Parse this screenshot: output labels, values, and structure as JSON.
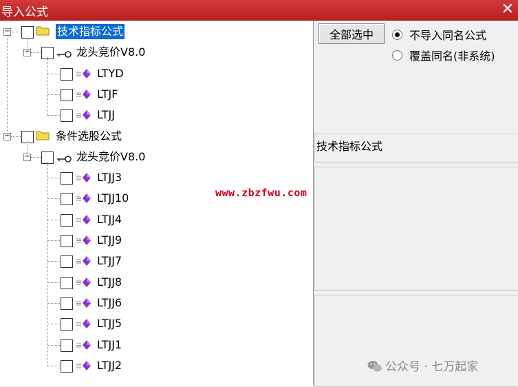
{
  "window": {
    "title": "导入公式",
    "close_glyph": "✕"
  },
  "tree": {
    "groups": [
      {
        "label": "技术指标公式",
        "selected": true,
        "folder": {
          "label": "龙头竞价V8.0",
          "items": [
            "LTYD",
            "LTJF",
            "LTJJ"
          ]
        }
      },
      {
        "label": "条件选股公式",
        "selected": false,
        "folder": {
          "label": "龙头竞价V8.0",
          "items": [
            "LTJJ3",
            "LTJJ10",
            "LTJJ4",
            "LTJJ9",
            "LTJJ7",
            "LTJJ8",
            "LTJJ6",
            "LTJJ5",
            "LTJJ1",
            "LTJJ2"
          ]
        }
      }
    ],
    "expander_glyph": "−"
  },
  "right": {
    "select_all_button": "全部选中",
    "radio_options": [
      {
        "label": "不导入同名公式",
        "checked": true
      },
      {
        "label": "覆盖同名(非系统)",
        "checked": false
      }
    ],
    "section_label": "技术指标公式"
  },
  "overlay": {
    "watermark": "www.zbzfwu.com",
    "footer": "公众号 · 七万起家"
  },
  "colors": {
    "title_bar": "#c22b2b",
    "selection": "#0a6bd2",
    "gem": "#8b2fc9",
    "watermark": "#d4001c"
  }
}
